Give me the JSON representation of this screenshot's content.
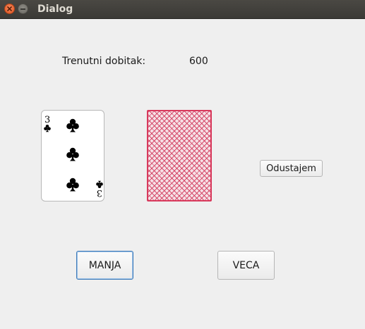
{
  "window": {
    "title": "Dialog",
    "close_icon": "close-icon",
    "minimize_icon": "minimize-icon"
  },
  "winnings": {
    "label": "Trenutni dobitak:",
    "value": "600"
  },
  "cards": {
    "shown": {
      "rank": "3",
      "suit": "clubs",
      "suit_symbol": "♣"
    },
    "hidden": {
      "back_color": "#d8395c"
    }
  },
  "buttons": {
    "quit": "Odustajem",
    "lower": "MANJA",
    "higher": "VECA"
  },
  "colors": {
    "title_bar": "#3b3a36",
    "close_button": "#e2541f",
    "focus_border": "#3f7ab8"
  }
}
